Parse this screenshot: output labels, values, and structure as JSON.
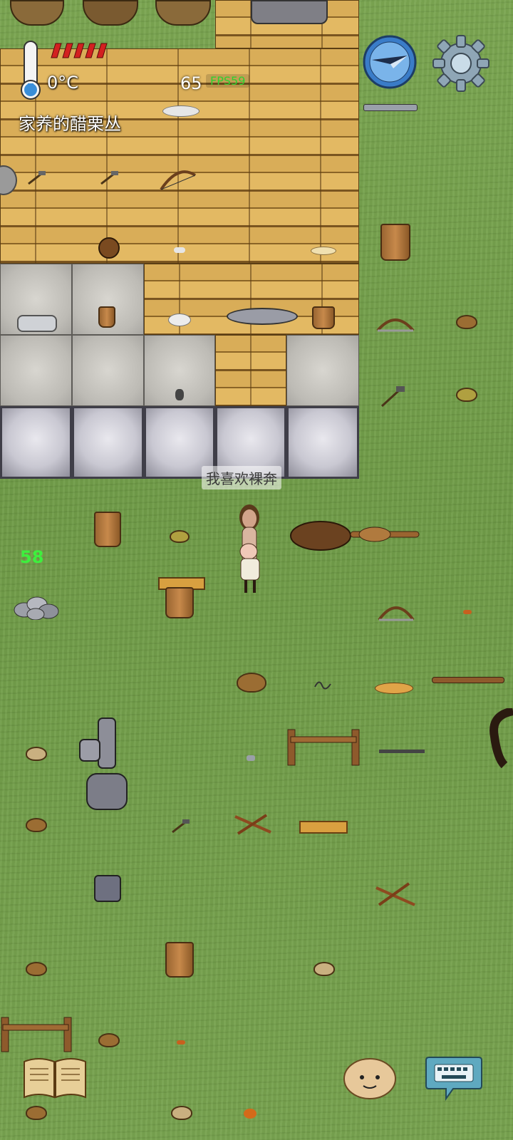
{
  "hud": {
    "temperature": "0°C",
    "hint_text": "家养的醋栗丛",
    "counter": "65",
    "fps": "FPS59",
    "health_segments": 5,
    "temperature_fill": 0.15
  },
  "world": {
    "speech_bubble": "我喜欢裸奔",
    "green_number": "58"
  },
  "icons": {
    "thermometer": "thermometer-icon",
    "health": "health-bar-icon",
    "compass": "compass-icon",
    "settings": "gear-icon",
    "book": "recipe-book-icon",
    "emote": "emote-face-icon",
    "keyboard": "keyboard-chat-icon"
  },
  "colors": {
    "grass": "#6f9a4a",
    "plank": "#d9ad58",
    "fps_green": "#2fd12f",
    "health_red": "#d32020",
    "compass_blue": "#3a7cc8"
  }
}
